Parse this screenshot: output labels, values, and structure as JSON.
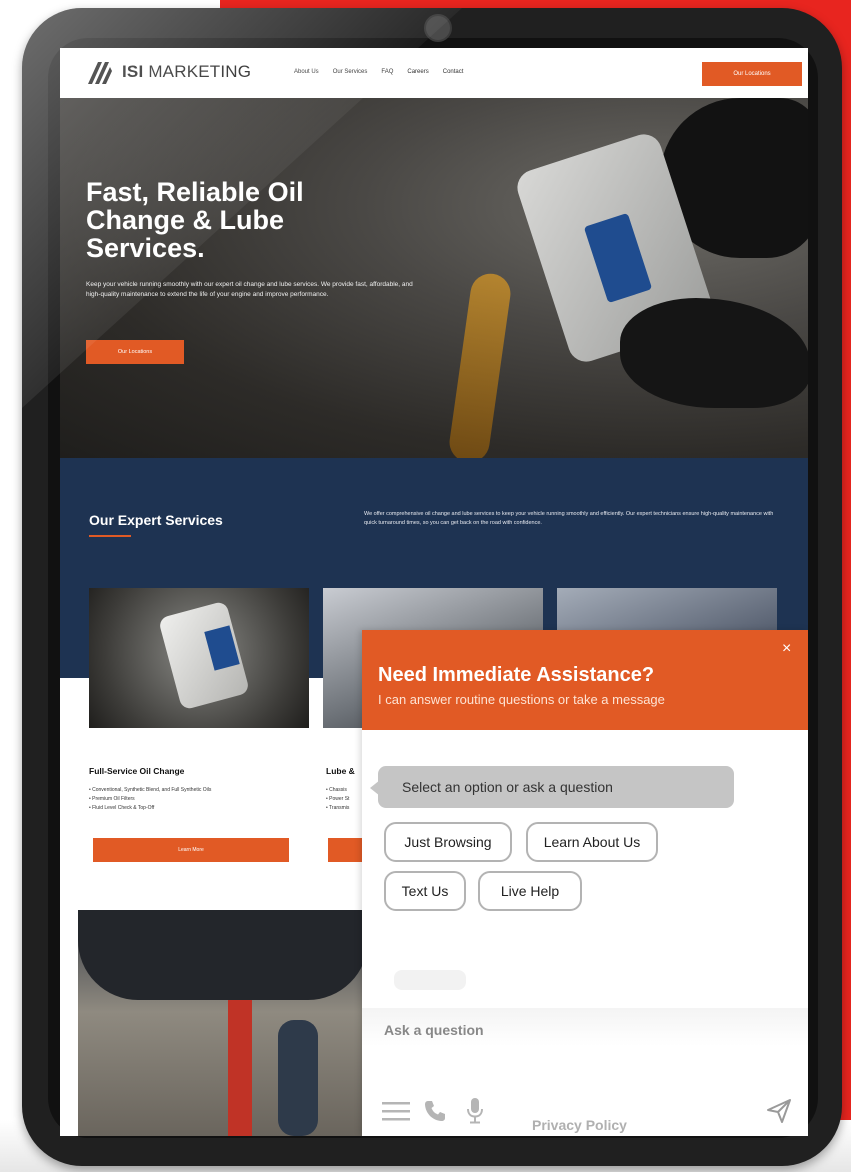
{
  "site": {
    "logo_bold": "ISI",
    "logo_rest": " MARKETING",
    "nav": [
      "About Us",
      "Our Services",
      "FAQ",
      "Careers",
      "Contact"
    ],
    "header_cta": "Our Locations"
  },
  "hero": {
    "title": "Fast, Reliable Oil Change & Lube Services.",
    "description": "Keep your vehicle running smoothly with our expert oil change and lube services. We provide fast, affordable, and high-quality maintenance to extend the life of your engine and improve performance.",
    "cta": "Our Locations"
  },
  "services": {
    "title": "Our Expert Services",
    "description": "We offer comprehensive oil change and lube services to keep your vehicle running smoothly and efficiently. Our expert technicians ensure high-quality maintenance with quick turnaround times, so you can get back on the road with confidence.",
    "cards": [
      {
        "title": "Full-Service Oil Change",
        "bullets": [
          "• Conventional, Synthetic Blend, and Full Synthetic Oils",
          "• Premium Oil Filters",
          "• Fluid Level Check & Top-Off"
        ],
        "button": "Learn More"
      },
      {
        "title": "Lube &",
        "bullets": [
          "• Chassis",
          "• Power St",
          "• Transmis"
        ]
      }
    ]
  },
  "chat": {
    "close": "×",
    "title": "Need Immediate Assistance?",
    "subtitle": "I can answer routine questions or take a message",
    "prompt": "Select an option or ask a question",
    "options": [
      "Just Browsing",
      "Learn About Us",
      "Text Us",
      "Live Help"
    ],
    "input_placeholder": "Ask a question",
    "privacy": "Privacy Policy",
    "accent": "#e15a25"
  },
  "icons": [
    "menu-icon",
    "phone-icon",
    "microphone-icon",
    "send-icon",
    "close-icon"
  ]
}
